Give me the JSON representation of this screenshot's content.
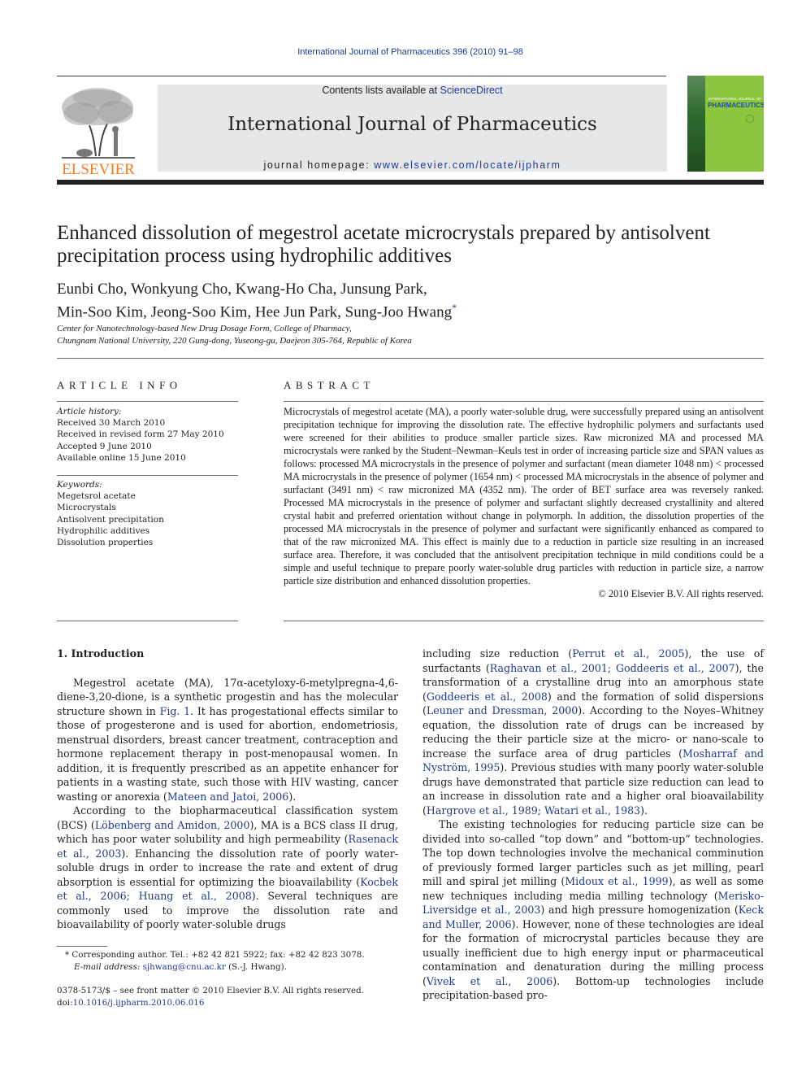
{
  "header": {
    "citation": "International Journal of Pharmaceutics 396 (2010) 91–98",
    "contents_prefix": "Contents lists available at ",
    "contents_link": "ScienceDirect",
    "journal_title": "International Journal of Pharmaceutics",
    "homepage_prefix": "journal homepage: ",
    "homepage_link": "www.elsevier.com/locate/ijpharm",
    "publisher_logo_text": "ELSEVIER",
    "cover": {
      "line1": "INTERNATIONAL JOURNAL OF",
      "line2": "PHARMACEUTICS"
    }
  },
  "article": {
    "title": "Enhanced dissolution of megestrol acetate microcrystals prepared by antisolvent precipitation process using hydrophilic additives",
    "authors_line1": "Eunbi Cho, Wonkyung Cho, Kwang-Ho Cha, Junsung Park,",
    "authors_line2": "Min-Soo Kim, Jeong-Soo Kim, Hee Jun Park, Sung-Joo Hwang",
    "corresponding_mark": "*",
    "affiliation_line1": "Center for Nanotechnology-based New Drug Dosage Form, College of Pharmacy,",
    "affiliation_line2": "Chungnam National University, 220 Gung-dong, Yuseong-gu, Daejeon 305-764, Republic of Korea"
  },
  "article_info": {
    "heading": "ARTICLE INFO",
    "history_label": "Article history:",
    "history": [
      "Received 30 March 2010",
      "Received in revised form 27 May 2010",
      "Accepted 9 June 2010",
      "Available online 15 June 2010"
    ],
    "keywords_label": "Keywords:",
    "keywords": [
      "Megetsrol acetate",
      "Microcrystals",
      "Antisolvent precipitation",
      "Hydrophilic additives",
      "Dissolution properties"
    ]
  },
  "abstract": {
    "heading": "ABSTRACT",
    "text": "Microcrystals of megestrol acetate (MA), a poorly water-soluble drug, were successfully prepared using an antisolvent precipitation technique for improving the dissolution rate. The effective hydrophilic polymers and surfactants used were screened for their abilities to produce smaller particle sizes. Raw micronized MA and processed MA microcrystals were ranked by the Student–Newman–Keuls test in order of increasing particle size and SPAN values as follows: processed MA microcrystals in the presence of polymer and surfactant (mean diameter 1048 nm) < processed MA microcrystals in the presence of polymer (1654 nm) < processed MA microcrystals in the absence of polymer and surfactant (3491 nm) < raw micronized MA (4352 nm). The order of BET surface area was reversely ranked. Processed MA microcrystals in the presence of polymer and surfactant slightly decreased crystallinity and altered crystal habit and preferred orientation without change in polymorph. In addition, the dissolution properties of the processed MA microcrystals in the presence of polymer and surfactant were significantly enhanced as compared to that of the raw micronized MA. This effect is mainly due to a reduction in particle size resulting in an increased surface area. Therefore, it was concluded that the antisolvent precipitation technique in mild conditions could be a simple and useful technique to prepare poorly water-soluble drug particles with reduction in particle size, a narrow particle size distribution and enhanced dissolution properties.",
    "copyright": "© 2010 Elsevier B.V. All rights reserved."
  },
  "body": {
    "section_heading": "1.  Introduction",
    "left_col": {
      "p1_a": "Megestrol acetate (MA), 17α-acetyloxy-6-metylpregna-4,6-diene-3,20-dione, is a synthetic progestin and has the molecular structure shown in ",
      "p1_link1": "Fig. 1",
      "p1_b": ". It has progestational effects similar to those of progesterone and is used for abortion, endometriosis, menstrual disorders, breast cancer treatment, contraception and hormone replacement therapy in post-menopausal women. In addition, it is frequently prescribed as an appetite enhancer for patients in a wasting state, such those with HIV wasting, cancer wasting or anorexia (",
      "p1_link2": "Mateen and Jatoi, 2006",
      "p1_c": ").",
      "p2_a": "According to the biopharmaceutical classification system (BCS) (",
      "p2_link1": "Löbenberg and Amidon, 2000",
      "p2_b": "), MA is a BCS class II drug, which has poor water solubility and high permeability (",
      "p2_link2": "Rasenack et al., 2003",
      "p2_c": "). Enhancing the dissolution rate of poorly water-soluble drugs in order to increase the rate and extent of drug absorption is essential for optimizing the bioavailability (",
      "p2_link3": "Kocbek et al., 2006; Huang et al., 2008",
      "p2_d": "). Several techniques are commonly used to improve the dissolution rate and bioavailability of poorly water-soluble drugs"
    },
    "right_col": {
      "p1_a": "including size reduction (",
      "p1_link1": "Perrut et al., 2005",
      "p1_b": "), the use of surfactants (",
      "p1_link2": "Raghavan et al., 2001; Goddeeris et al., 2007",
      "p1_c": "), the transformation of a crystalline drug into an amorphous state (",
      "p1_link3": "Goddeeris et al., 2008",
      "p1_d": ") and the formation of solid dispersions (",
      "p1_link4": "Leuner and Dressman, 2000",
      "p1_e": "). According to the Noyes–Whitney equation, the dissolution rate of drugs can be increased by reducing the their particle size at the micro- or nano-scale to increase the surface area of drug particles (",
      "p1_link5": "Mosharraf and Nyström, 1995",
      "p1_f": "). Previous studies with many poorly water-soluble drugs have demonstrated that particle size reduction can lead to an increase in dissolution rate and a higher oral bioavailability (",
      "p1_link6": "Hargrove et al., 1989; Watari et al., 1983",
      "p1_g": ").",
      "p2_a": "The existing technologies for reducing particle size can be divided into so-called “top down” and “bottom-up” technologies. The top down technologies involve the mechanical comminution of previously formed larger particles such as jet milling, pearl mill and spiral jet milling (",
      "p2_link1": "Midoux et al., 1999",
      "p2_b": "), as well as some new techniques including media milling technology (",
      "p2_link2": "Merisko-Liversidge et al., 2003",
      "p2_c": ") and high pressure homogenization (",
      "p2_link3": "Keck and Muller, 2006",
      "p2_d": "). However, none of these technologies are ideal for the formation of microcrystal particles because they are usually inefficient due to high energy input or pharmaceutical contamination and denaturation during the milling process (",
      "p2_link4": "Vivek et al., 2006",
      "p2_e": "). Bottom-up technologies include precipitation-based pro-"
    }
  },
  "footnotes": {
    "corresponding": "* Corresponding author. Tel.: +82 42 821 5922; fax: +82 42 823 3078.",
    "email_label": "E-mail address: ",
    "email": "sjhwang@cnu.ac.kr",
    "email_suffix": " (S.-J. Hwang).",
    "front_matter": "0378-5173/$ – see front matter © 2010 Elsevier B.V. All rights reserved.",
    "doi_prefix": "doi:",
    "doi": "10.1016/j.ijpharm.2010.06.016"
  },
  "colors": {
    "link": "#1f3a8f",
    "elsevier_orange": "#f47c20",
    "band_gray": "#e6e7e8",
    "cover_green": "#8cc63f"
  }
}
